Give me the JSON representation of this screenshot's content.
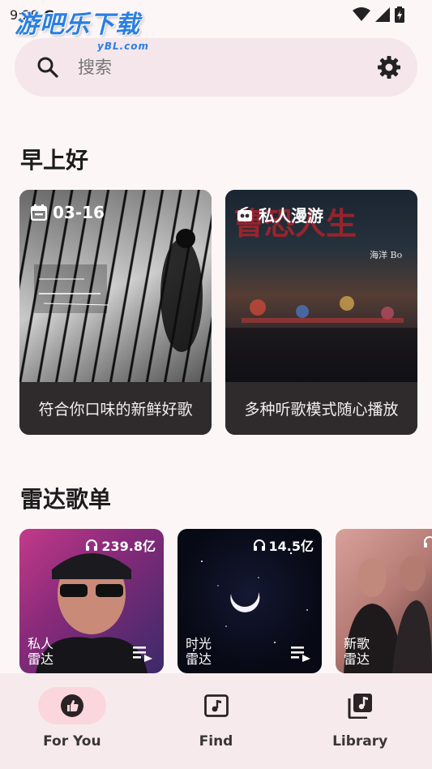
{
  "status_bar": {
    "time": "9:29",
    "carrier_glyph": "G"
  },
  "watermark": {
    "title": "游吧乐下载",
    "subtitle": "yBL.com"
  },
  "search": {
    "placeholder": "搜索"
  },
  "greeting": "早上好",
  "featured": [
    {
      "tag": "03-16",
      "tag_icon": "calendar-icon",
      "caption": "符合你口味的新鲜好歌"
    },
    {
      "tag": "私人漫游",
      "tag_icon": "radio-icon",
      "caption": "多种听歌模式随心播放"
    }
  ],
  "radar_section_title": "雷达歌单",
  "radar": [
    {
      "plays": "239.8亿",
      "name": "私人雷达"
    },
    {
      "plays": "14.5亿",
      "name": "时光雷达"
    },
    {
      "plays": "",
      "name": "新歌雷达"
    }
  ],
  "nav": [
    {
      "label": "For You",
      "icon": "thumb-up-icon",
      "active": true
    },
    {
      "label": "Find",
      "icon": "music-note-icon",
      "active": false
    },
    {
      "label": "Library",
      "icon": "library-music-icon",
      "active": false
    }
  ],
  "colors": {
    "accent_pill": "#fbd6dd",
    "search_bg": "#f4e6ea",
    "nav_bg": "#f7eaed"
  }
}
